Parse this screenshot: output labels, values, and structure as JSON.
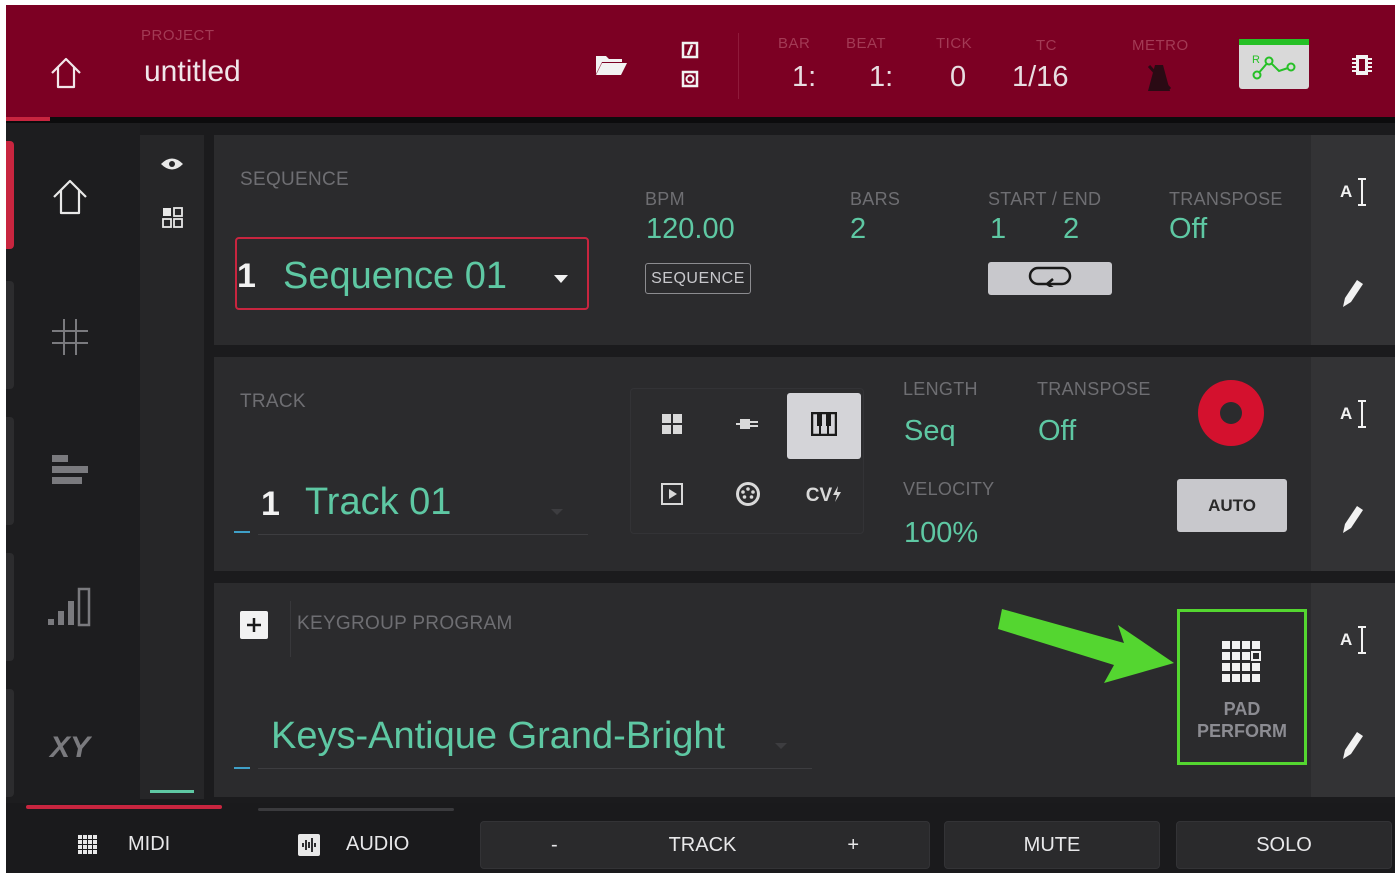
{
  "header": {
    "project_label": "PROJECT",
    "project_name": "untitled",
    "bar_label": "BAR",
    "bar_value": "1:",
    "beat_label": "BEAT",
    "beat_value": "1:",
    "tick_label": "TICK",
    "tick_value": "0",
    "tc_label": "TC",
    "tc_value": "1/16",
    "metro_label": "METRO"
  },
  "sequence": {
    "label": "SEQUENCE",
    "number": "1",
    "name": "Sequence 01",
    "bpm_label": "BPM",
    "bpm_value": "120.00",
    "sequence_button": "SEQUENCE",
    "bars_label": "BARS",
    "bars_value": "2",
    "start_end_label": "START / END",
    "start_value": "1",
    "end_value": "2",
    "transpose_label": "TRANSPOSE",
    "transpose_value": "Off"
  },
  "track": {
    "label": "TRACK",
    "number": "1",
    "name": "Track 01",
    "cv_label": "CV",
    "length_label": "LENGTH",
    "length_value": "Seq",
    "transpose_label": "TRANSPOSE",
    "transpose_value": "Off",
    "velocity_label": "VELOCITY",
    "velocity_value": "100%",
    "auto_button": "AUTO",
    "record_color": "#d4112e"
  },
  "program": {
    "label": "KEYGROUP PROGRAM",
    "name": "Keys-Antique Grand-Bright",
    "pad_perform_line1": "PAD",
    "pad_perform_line2": "PERFORM",
    "highlight_color": "#54d630"
  },
  "bottom_bar": {
    "midi": "MIDI",
    "audio": "AUDIO",
    "minus": "-",
    "track": "TRACK",
    "plus": "+",
    "mute": "MUTE",
    "solo": "SOLO"
  },
  "colors": {
    "header_bg": "#7c0023",
    "accent_red": "#c8253f",
    "teal_value": "#5ec8a3",
    "annotation_arrow": "#54d630"
  },
  "icons": {
    "home": "home-icon",
    "folder": "folder-icon",
    "undo_redo": "undo-redo-icon",
    "metronome": "metronome-icon",
    "automation": "automation-icon",
    "tools": "tools-icon",
    "eye": "eye-icon",
    "grid_view": "grid-view-icon",
    "pads": "pads-icon",
    "list": "list-icon",
    "levels": "levels-icon",
    "xy": "xy-icon",
    "text_edit": "text-edit-icon",
    "pencil": "pencil-icon",
    "loop": "loop-icon",
    "plus": "plus-icon"
  }
}
